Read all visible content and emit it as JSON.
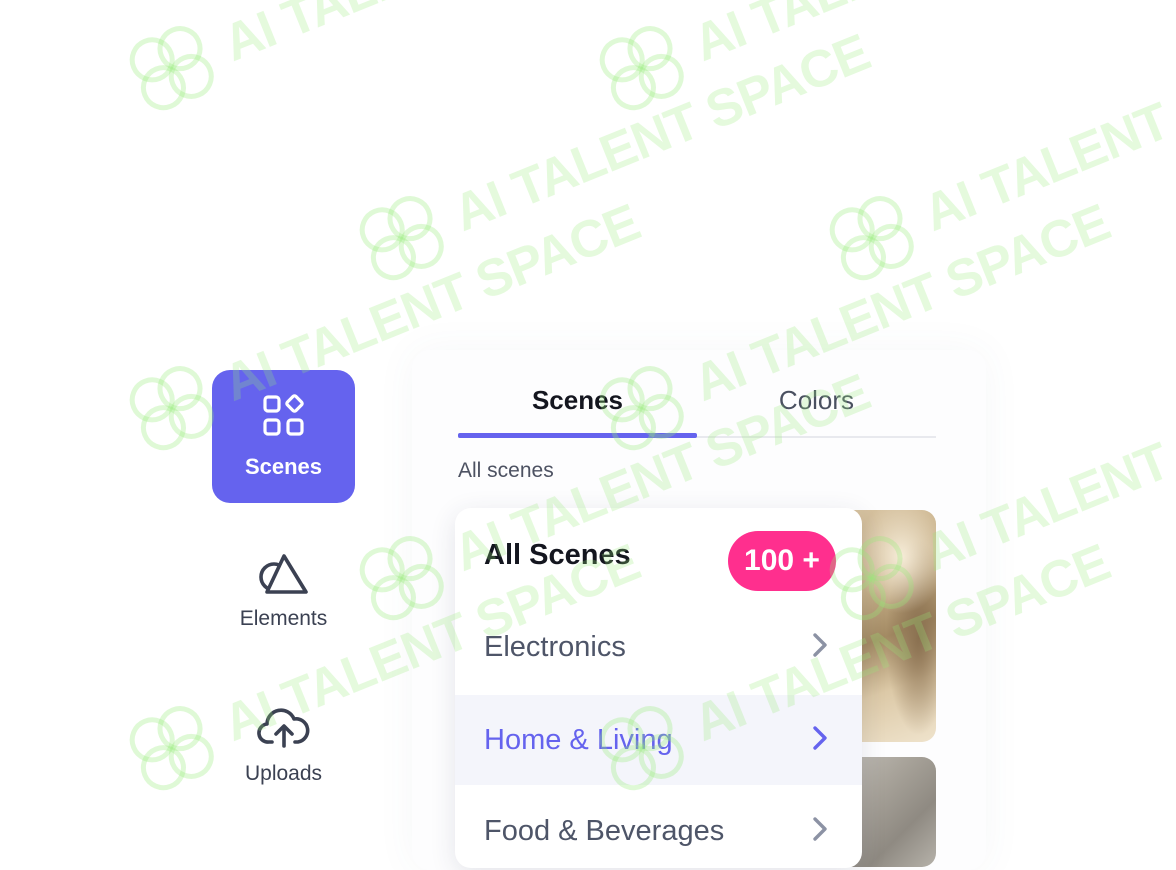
{
  "sidebar": {
    "items": [
      {
        "label": "Scenes",
        "icon": "shapes-icon",
        "active": true
      },
      {
        "label": "Elements",
        "icon": "triangle-circle-icon",
        "active": false
      },
      {
        "label": "Uploads",
        "icon": "cloud-upload-icon",
        "active": false
      }
    ]
  },
  "panel": {
    "tabs": [
      {
        "label": "Scenes",
        "active": true
      },
      {
        "label": "Colors",
        "active": false
      }
    ],
    "section_label": "All scenes",
    "dropdown": {
      "title": "All Scenes",
      "badge": "100 +",
      "items": [
        {
          "label": "Electronics",
          "selected": false
        },
        {
          "label": "Home & Living",
          "selected": true
        },
        {
          "label": "Food & Beverages",
          "selected": false
        }
      ]
    }
  },
  "watermark": "AI TALENT SPACE",
  "colors": {
    "accent": "#6563ee",
    "badge": "#ff2f8e",
    "text_dark": "#14161f",
    "text_muted": "#4e5568"
  }
}
